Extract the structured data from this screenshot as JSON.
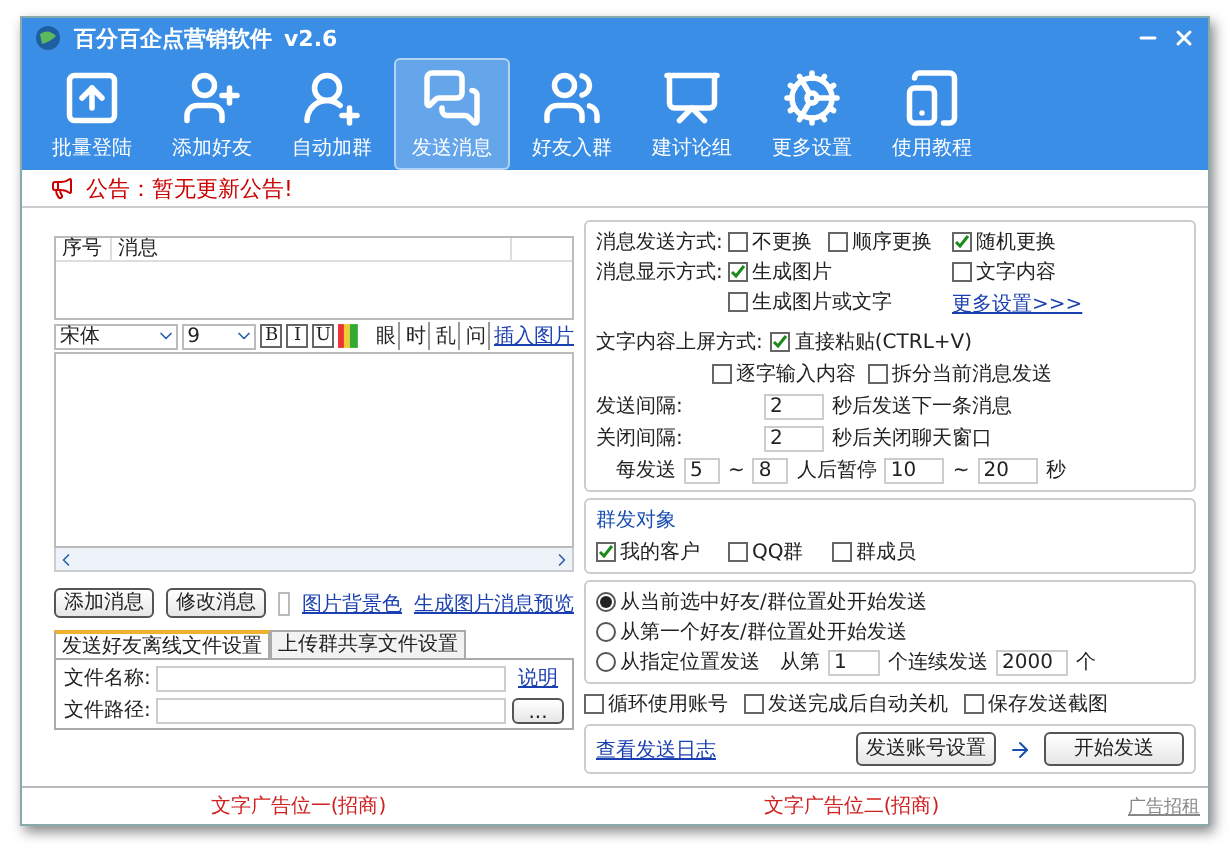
{
  "window": {
    "title": "百分百企点营销软件",
    "version": "v2.6"
  },
  "toolbar": [
    {
      "label": "批量登陆",
      "selected": false
    },
    {
      "label": "添加好友",
      "selected": false
    },
    {
      "label": "自动加群",
      "selected": false
    },
    {
      "label": "发送消息",
      "selected": true
    },
    {
      "label": "好友入群",
      "selected": false
    },
    {
      "label": "建讨论组",
      "selected": false
    },
    {
      "label": "更多设置",
      "selected": false
    },
    {
      "label": "使用教程",
      "selected": false
    }
  ],
  "notice": "公告：暂无更新公告!",
  "message_table": {
    "columns": [
      "序号",
      "消息"
    ]
  },
  "editor": {
    "font": "宋体",
    "size": "9",
    "format_buttons": [
      "B",
      "I",
      "U"
    ],
    "tools": [
      "眼",
      "时",
      "乱",
      "问"
    ],
    "insert_image": "插入图片"
  },
  "message_buttons": [
    "添加消息",
    "修改消息"
  ],
  "bg_color_label": "图片背景色",
  "preview_link": "生成图片消息预览",
  "file_tabs": [
    {
      "label": "发送好友离线文件设置",
      "selected": true
    },
    {
      "label": "上传群共享文件设置",
      "selected": false
    }
  ],
  "file_fields": [
    "文件名称:",
    "文件路径:"
  ],
  "help_link": "说明",
  "browse_button": "...",
  "send_mode": {
    "label": "消息发送方式:",
    "options": [
      {
        "label": "不更换",
        "checked": false
      },
      {
        "label": "顺序更换",
        "checked": false
      },
      {
        "label": "随机更换",
        "checked": true
      }
    ]
  },
  "display_mode": {
    "label": "消息显示方式:",
    "options": [
      {
        "label": "生成图片",
        "checked": true
      },
      {
        "label": "文字内容",
        "checked": false
      },
      {
        "label": "生成图片或文字",
        "checked": false
      }
    ]
  },
  "more_settings": "更多设置>>>",
  "paste_mode": {
    "label": "文字内容上屏方式:",
    "options": [
      {
        "label": "直接粘贴(CTRL+V)",
        "checked": true
      },
      {
        "label": "逐字输入内容",
        "checked": false
      },
      {
        "label": "拆分当前消息发送",
        "checked": false
      }
    ]
  },
  "intervals": [
    {
      "label": "发送间隔:",
      "value": "2",
      "suffix": "秒后发送下一条消息"
    },
    {
      "label": "关闭间隔:",
      "value": "2",
      "suffix": "秒后关闭聊天窗口"
    }
  ],
  "pause": {
    "prefix": "每发送",
    "from": "5",
    "tilde": "~",
    "to": "8",
    "middle": "人后暂停",
    "from2": "10",
    "tilde2": "~",
    "to2": "20",
    "unit": "秒"
  },
  "targets": {
    "title": "群发对象",
    "options": [
      {
        "label": "我的客户",
        "checked": true
      },
      {
        "label": "QQ群",
        "checked": false
      },
      {
        "label": "群成员",
        "checked": false
      }
    ]
  },
  "start_positions": [
    {
      "label": "从当前选中好友/群位置处开始发送",
      "selected": true
    },
    {
      "label": "从第一个好友/群位置处开始发送",
      "selected": false
    },
    {
      "label": "从指定位置发送",
      "selected": false
    }
  ],
  "position_fields": {
    "from_label": "从第",
    "from_value": "1",
    "count_label": "个连续发送",
    "count_value": "2000",
    "unit": "个"
  },
  "options": [
    {
      "label": "循环使用账号",
      "checked": false
    },
    {
      "label": "发送完成后自动关机",
      "checked": false
    },
    {
      "label": "保存发送截图",
      "checked": false
    }
  ],
  "log_link": "查看发送日志",
  "account_button": "发送账号设置",
  "start_button": "开始发送",
  "ads": [
    "文字广告位一(招商)",
    "文字广告位二(招商)"
  ],
  "ad_link": "广告招租"
}
